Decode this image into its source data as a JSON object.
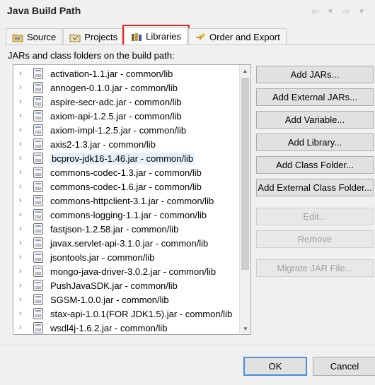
{
  "window": {
    "title": "Java Build Path"
  },
  "nav": {
    "back": "⇦",
    "back_drop": "▾",
    "forward": "⇨",
    "forward_drop": "▾"
  },
  "tabs": [
    {
      "label": "Source",
      "icon": "source-folder-icon"
    },
    {
      "label": "Projects",
      "icon": "projects-icon"
    },
    {
      "label": "Libraries",
      "icon": "libraries-icon",
      "active": true
    },
    {
      "label": "Order and Export",
      "icon": "order-export-icon"
    }
  ],
  "panel": {
    "label": "JARs and class folders on the build path:"
  },
  "libraries": [
    "activation-1.1.jar - common/lib",
    "annogen-0.1.0.jar - common/lib",
    "aspire-secr-adc.jar - common/lib",
    "axiom-api-1.2.5.jar - common/lib",
    "axiom-impl-1.2.5.jar - common/lib",
    "axis2-1.3.jar - common/lib",
    "bcprov-jdk16-1.46.jar - common/lib",
    "commons-codec-1.3.jar - common/lib",
    "commons-codec-1.6.jar - common/lib",
    "commons-httpclient-3.1.jar - common/lib",
    "commons-logging-1.1.jar - common/lib",
    "fastjson-1.2.58.jar - common/lib",
    "javax.servlet-api-3.1.0.jar - common/lib",
    "jsontools.jar - common/lib",
    "mongo-java-driver-3.0.2.jar - common/lib",
    "PushJavaSDK.jar - common/lib",
    "SGSM-1.0.0.jar - common/lib",
    "stax-api-1.0.1(FOR JDK1.5).jar - common/lib",
    "wsdl4j-1.6.2.jar - common/lib"
  ],
  "jar_icon_text": "010",
  "highlighted_index": 6,
  "buttons": {
    "add_jars": "Add JARs...",
    "add_external_jars": "Add External JARs...",
    "add_variable": "Add Variable...",
    "add_library": "Add Library...",
    "add_class_folder": "Add Class Folder...",
    "add_external_class_folder": "Add External Class Folder...",
    "edit": "Edit...",
    "remove": "Remove",
    "migrate_jar_file": "Migrate JAR File..."
  },
  "dialog": {
    "ok": "OK",
    "cancel": "Cancel"
  },
  "colors": {
    "highlight_outline": "#e8231d",
    "selection_bg": "#e5f0fb",
    "default_button_border": "#4a8fd8"
  }
}
